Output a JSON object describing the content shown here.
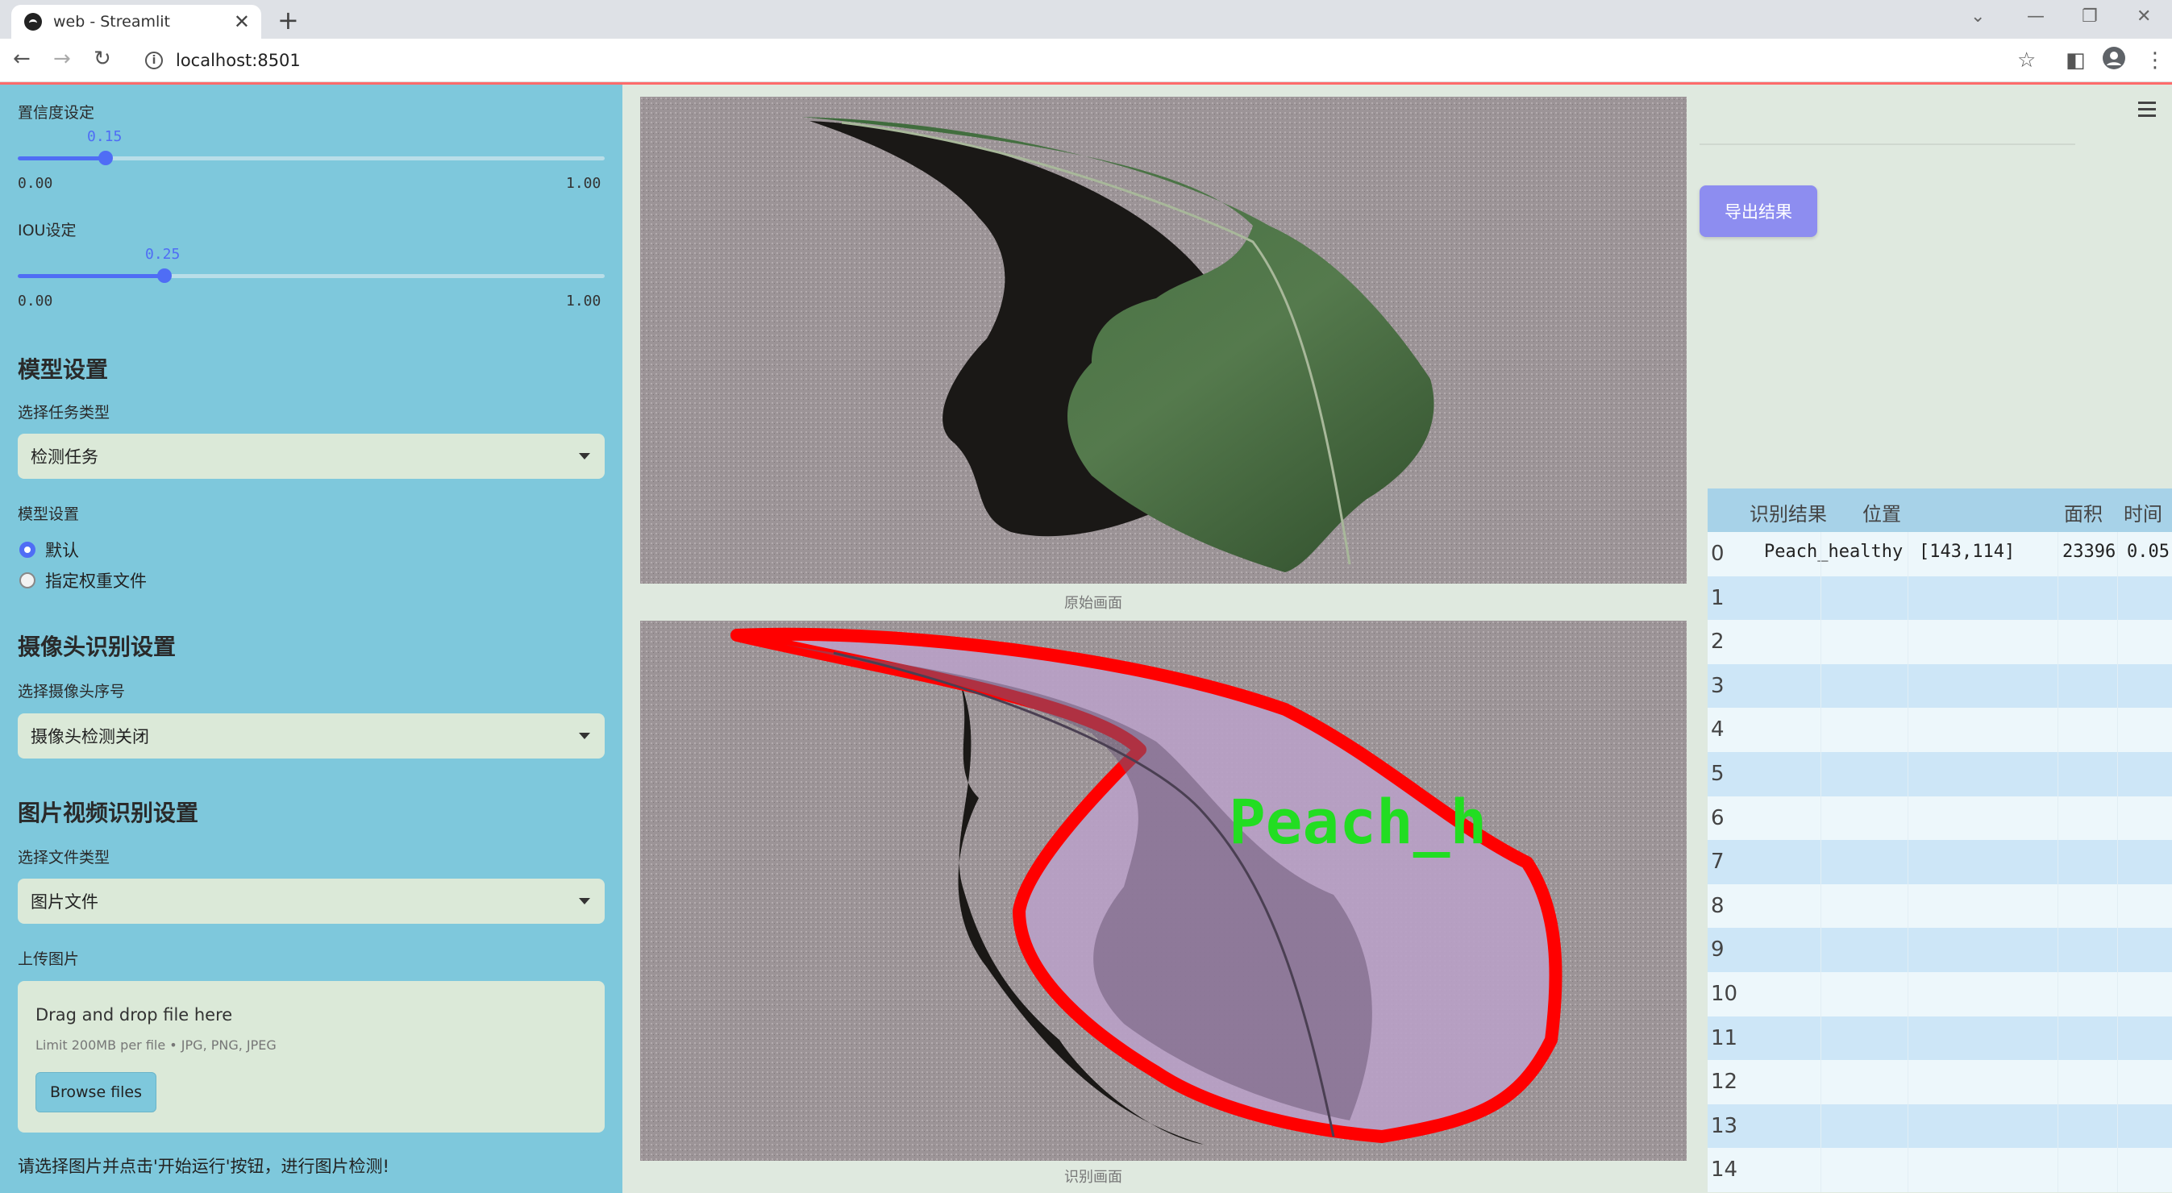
{
  "browser": {
    "tab_title": "web - Streamlit",
    "url": "localhost:8501"
  },
  "sidebar": {
    "confidence": {
      "label": "置信度设定",
      "value": "0.15",
      "value_fraction": 0.15,
      "min": "0.00",
      "max": "1.00"
    },
    "iou": {
      "label": "IOU设定",
      "value": "0.25",
      "value_fraction": 0.25,
      "min": "0.00",
      "max": "1.00"
    },
    "model_section": "模型设置",
    "task_label": "选择任务类型",
    "task_value": "检测任务",
    "model_label": "模型设置",
    "model_options": [
      "默认",
      "指定权重文件"
    ],
    "model_selected": 0,
    "camera_section": "摄像头识别设置",
    "camera_label": "选择摄像头序号",
    "camera_value": "摄像头检测关闭",
    "file_section": "图片视频识别设置",
    "filetype_label": "选择文件类型",
    "filetype_value": "图片文件",
    "upload_label": "上传图片",
    "upload": {
      "drag_text": "Drag and drop file here",
      "limit_text": "Limit 200MB per file • JPG, PNG, JPEG",
      "browse_label": "Browse files"
    },
    "note": "请选择图片并点击'开始运行'按钮，进行图片检测!"
  },
  "main": {
    "original_caption": "原始画面",
    "result_caption": "识别画面",
    "detection_label": "Peach_h",
    "export_label": "导出结果"
  },
  "table": {
    "headers": [
      "识别结果",
      "位置",
      "面积",
      "时间"
    ],
    "rows": [
      {
        "idx": "0",
        "result": "Peach_healthy",
        "position": "[143,114]",
        "area": "23396",
        "time": "0.05"
      },
      {
        "idx": "1"
      },
      {
        "idx": "2"
      },
      {
        "idx": "3"
      },
      {
        "idx": "4"
      },
      {
        "idx": "5"
      },
      {
        "idx": "6"
      },
      {
        "idx": "7"
      },
      {
        "idx": "8"
      },
      {
        "idx": "9"
      },
      {
        "idx": "10"
      },
      {
        "idx": "11"
      },
      {
        "idx": "12"
      },
      {
        "idx": "13"
      },
      {
        "idx": "14"
      }
    ]
  },
  "colors": {
    "sidebar_bg": "#7ec8dc",
    "accent": "#4f6df5",
    "detection_outline": "#ff0000",
    "detection_text": "#22dd22",
    "export_button": "#8d8df0"
  }
}
